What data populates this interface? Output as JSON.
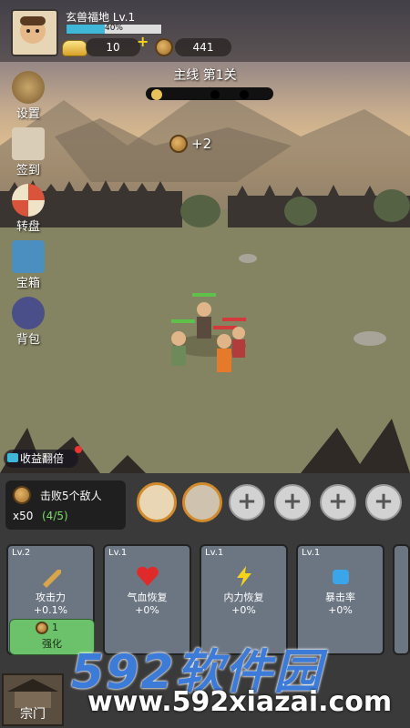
{
  "player": {
    "name": "玄兽福地 Lv.1",
    "xp_text": "40%",
    "xp_fraction": 0.4
  },
  "resources": {
    "gold": "10",
    "coins": "441"
  },
  "stage": {
    "title": "主线 第1关"
  },
  "reward_popup": "+2",
  "side_menu": [
    {
      "label": "设置",
      "icon": "gear-icon"
    },
    {
      "label": "签到",
      "icon": "calendar-icon"
    },
    {
      "label": "转盘",
      "icon": "wheel-icon"
    },
    {
      "label": "宝箱",
      "icon": "chest-icon"
    },
    {
      "label": "背包",
      "icon": "bag-icon"
    }
  ],
  "bonus_label": "收益翻倍",
  "quest": {
    "title": "击败5个敌人",
    "reward": "x50",
    "progress": "(4/5)"
  },
  "cards": [
    {
      "level": "Lv.2",
      "name": "攻击力",
      "value": "+0.1%",
      "icon": "sword-icon"
    },
    {
      "level": "Lv.1",
      "name": "气血恢复",
      "value": "+0%",
      "icon": "heart-icon"
    },
    {
      "level": "Lv.1",
      "name": "内力恢复",
      "value": "+0%",
      "icon": "lightning-icon"
    },
    {
      "level": "Lv.1",
      "name": "暴击率",
      "value": "+0%",
      "icon": "fist-icon"
    }
  ],
  "upgrade": {
    "cost": "1",
    "label": "强化"
  },
  "sect_label": "宗门",
  "watermark": {
    "brand": "592软件园",
    "url": "www.592xiazai.com"
  },
  "colors": {
    "accent_blue": "#3d7bd9",
    "xp_bar": "#3fb7d8",
    "upgrade_green": "#6cc26a"
  }
}
